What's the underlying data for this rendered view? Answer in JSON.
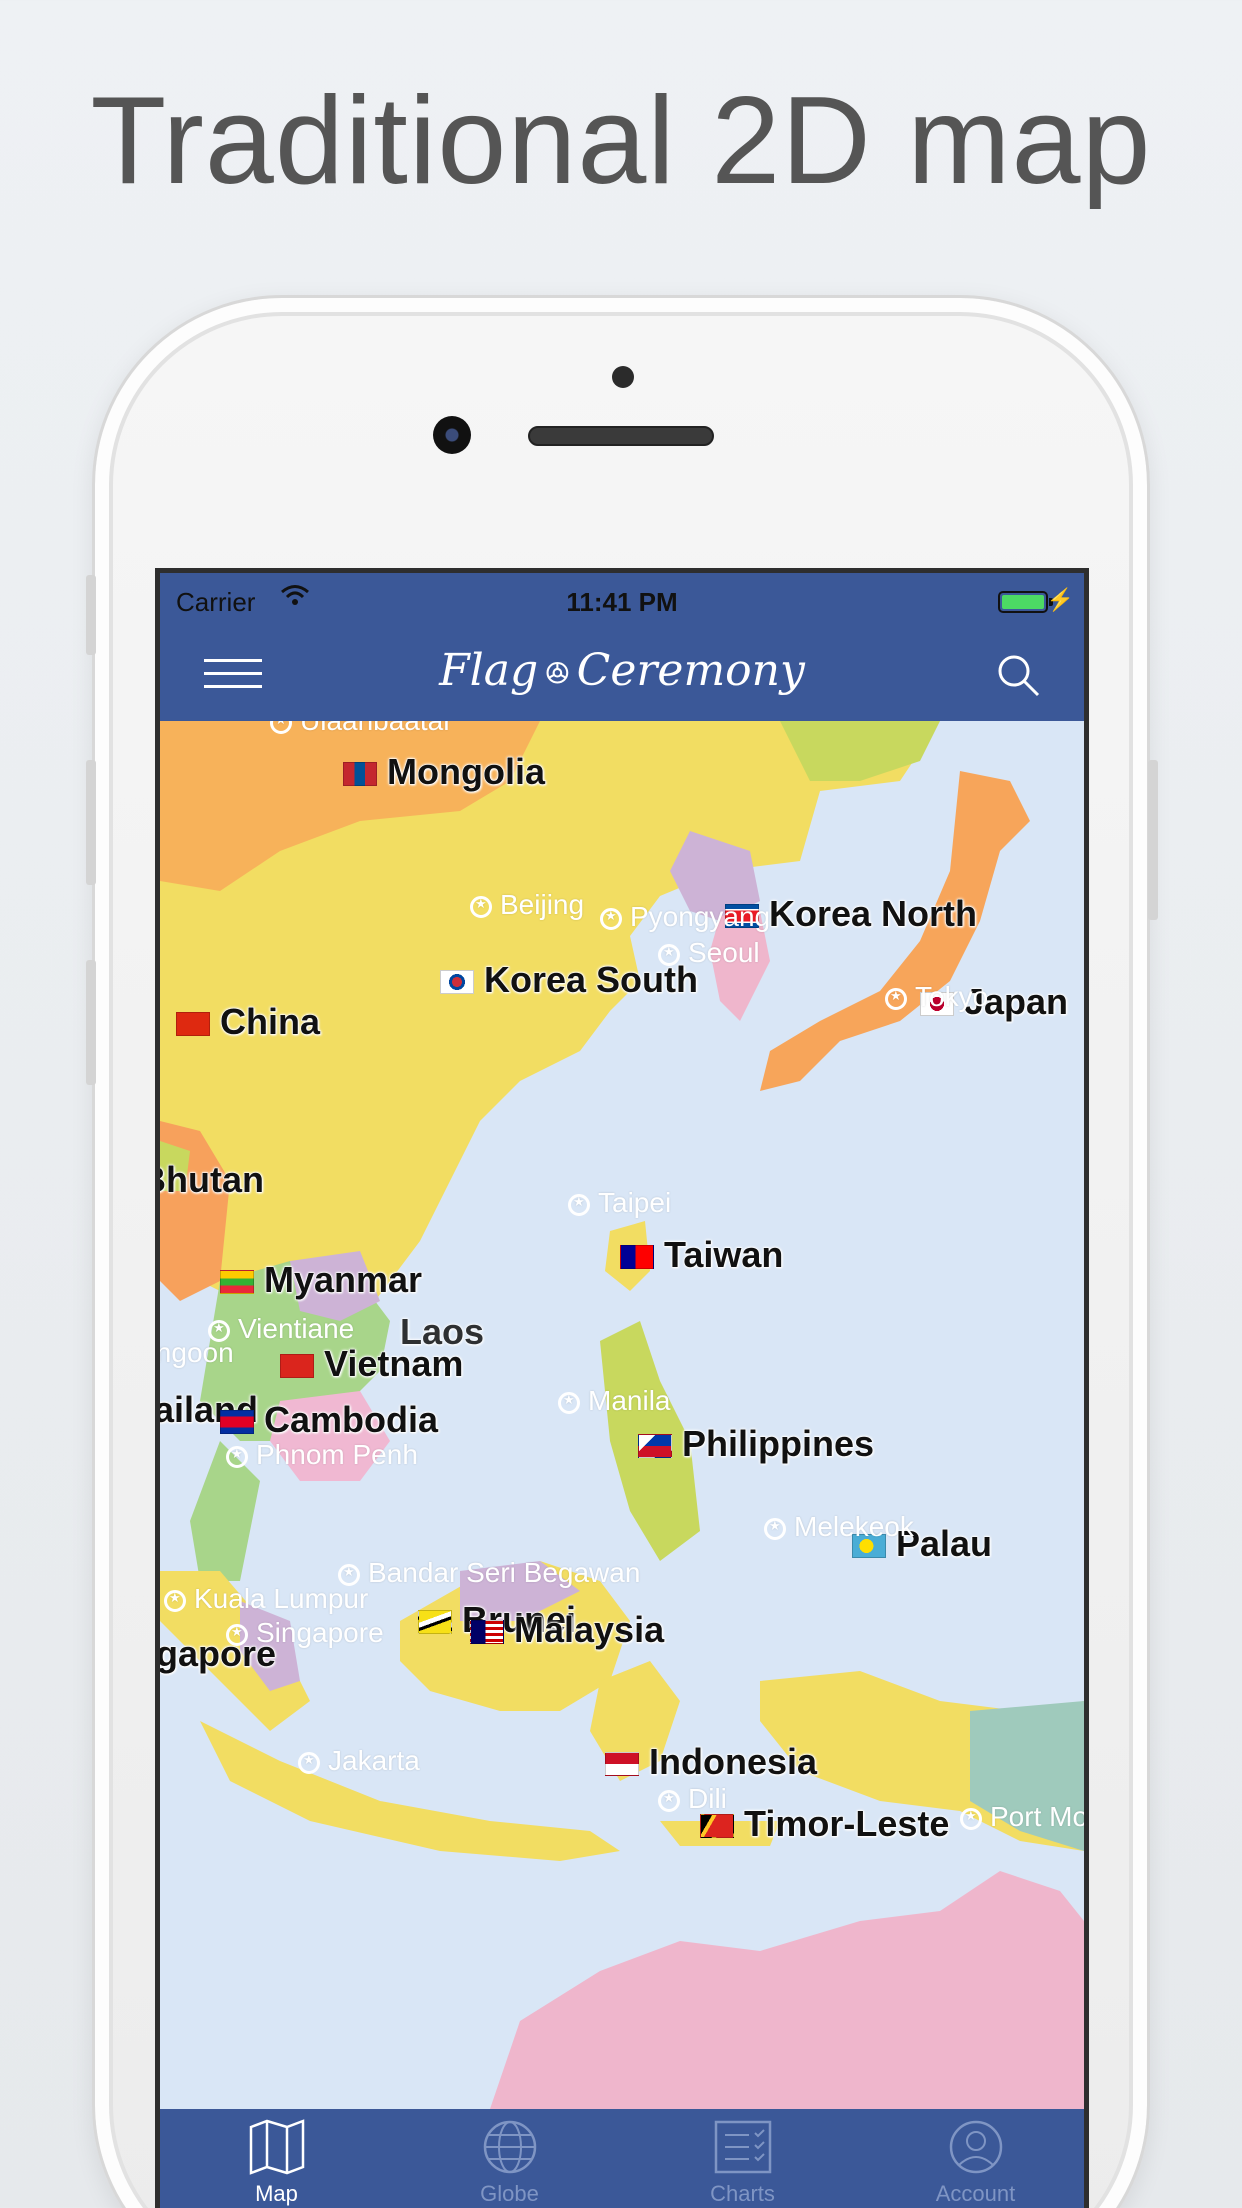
{
  "headline": "Traditional 2D map",
  "status": {
    "carrier": "Carrier",
    "time": "11:41 PM"
  },
  "app": {
    "brand_left": "Flag",
    "brand_mid": "ꔮ",
    "brand_right": "Ceremony"
  },
  "countries": [
    {
      "name": "Mongolia",
      "flag": "mongolia"
    },
    {
      "name": "Korea North",
      "flag": "korea-north"
    },
    {
      "name": "Korea South",
      "flag": "korea-south"
    },
    {
      "name": "China",
      "flag": "china"
    },
    {
      "name": "Japan",
      "flag": "japan"
    },
    {
      "name": "Bhutan",
      "flag": ""
    },
    {
      "name": "Taiwan",
      "flag": "taiwan"
    },
    {
      "name": "Myanmar",
      "flag": "myanmar"
    },
    {
      "name": "Laos",
      "flag": ""
    },
    {
      "name": "Vietnam",
      "flag": "vietnam"
    },
    {
      "name": "Thailand",
      "flag": ""
    },
    {
      "name": "Cambodia",
      "flag": "cambodia"
    },
    {
      "name": "Philippines",
      "flag": "philippines"
    },
    {
      "name": "Palau",
      "flag": "palau"
    },
    {
      "name": "Brunei",
      "flag": "brunei"
    },
    {
      "name": "Malaysia",
      "flag": "malaysia"
    },
    {
      "name": "Singapore",
      "flag": ""
    },
    {
      "name": "Indonesia",
      "flag": "indonesia"
    },
    {
      "name": "Timor-Leste",
      "flag": "timor-leste"
    }
  ],
  "capitals": [
    "Ulaanbaatar",
    "Beijing",
    "Pyongyang",
    "Seoul",
    "Tokyo",
    "Taipei",
    "Vientiane",
    "Rangoon",
    "Phnom Penh",
    "Manila",
    "Melekeok",
    "Bandar Seri Begawan",
    "Kuala Lumpur",
    "Singapore",
    "Jakarta",
    "Dili",
    "Port Moresby"
  ],
  "tabs": [
    {
      "label": "Map",
      "icon": "map-icon",
      "active": true
    },
    {
      "label": "Globe",
      "icon": "globe-icon",
      "active": false
    },
    {
      "label": "Charts",
      "icon": "charts-icon",
      "active": false
    },
    {
      "label": "Account",
      "icon": "account-icon",
      "active": false
    }
  ],
  "colors": {
    "bar": "#3b5898",
    "sea": "#d9e6f6",
    "active_tab": "#ffffff",
    "inactive_tab": "#7f95c4"
  }
}
